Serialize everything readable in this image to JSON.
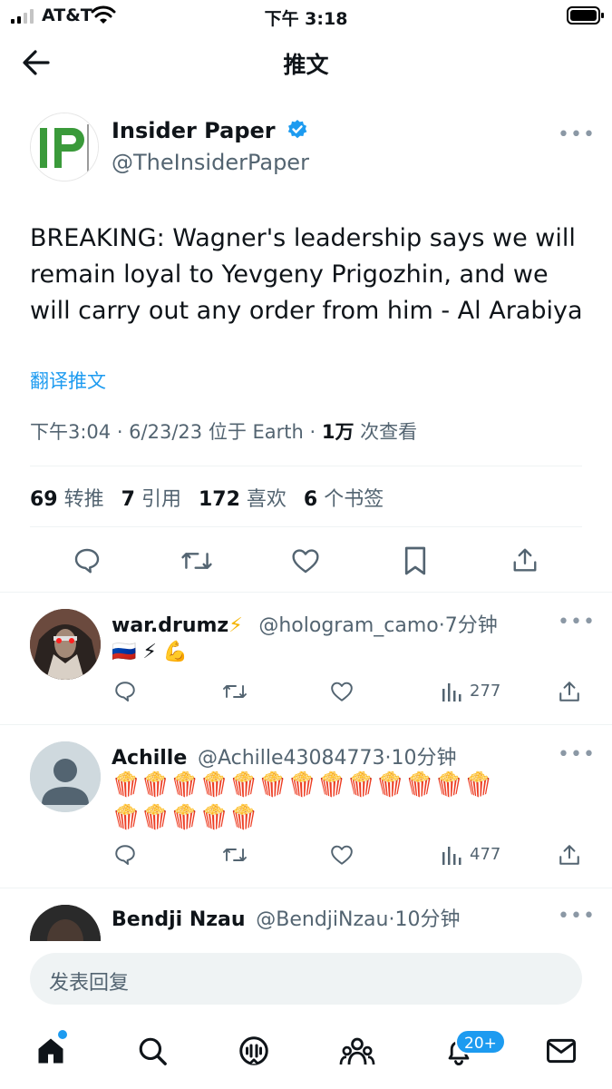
{
  "status_bar": {
    "carrier": "AT&T",
    "time": "下午 3:18"
  },
  "nav": {
    "title": "推文",
    "back_icon": "arrow-left-icon"
  },
  "main_tweet": {
    "author_name": "Insider Paper",
    "verified": true,
    "author_handle": "@TheInsiderPaper",
    "logo_text": "IP",
    "text": "BREAKING: Wagner's leadership says we will remain loyal to Yevgeny Prigozhin, and we will carry out any order from him - Al Arabiya",
    "translate_label": "翻译推文",
    "meta": {
      "time_date_location": "下午3:04 · 6/23/23 位于 Earth ·",
      "views_count": "1万",
      "views_label": "次查看"
    },
    "stats": [
      {
        "count": "69",
        "label": "转推"
      },
      {
        "count": "7",
        "label": "引用"
      },
      {
        "count": "172",
        "label": "喜欢"
      },
      {
        "count": "6",
        "label": "个书签"
      }
    ],
    "actions": [
      "reply-icon",
      "retweet-icon",
      "like-icon",
      "bookmark-icon",
      "share-icon"
    ]
  },
  "replies": [
    {
      "name": "war.drumz",
      "name_emoji": "⚡",
      "handle": "@hologram_camo",
      "time": "·7分钟",
      "text_line1": "🇷🇺 ⚡ 💪",
      "text_line2": "",
      "views": "277"
    },
    {
      "name": "Achille",
      "name_emoji": "",
      "handle": "@Achille43084773",
      "time": "·10分钟",
      "text_line1": "🍿🍿🍿🍿🍿🍿🍿🍿🍿🍿🍿🍿🍿",
      "text_line2": "🍿🍿🍿🍿🍿",
      "views": "477"
    },
    {
      "name": "Bendji Nzau",
      "name_emoji": "",
      "handle": "@BendjiNzau",
      "time": "·10分钟",
      "text_line1": "",
      "text_line2": "",
      "views": ""
    }
  ],
  "composer": {
    "placeholder": "发表回复"
  },
  "tab_bar": {
    "items": [
      "home-icon",
      "search-icon",
      "spaces-icon",
      "communities-icon",
      "notifications-icon",
      "messages-icon"
    ],
    "notification_badge": "20+"
  },
  "colors": {
    "accent": "#1d9bf0",
    "text": "#0f1419",
    "secondary": "#536471",
    "divider": "#eff3f4"
  }
}
